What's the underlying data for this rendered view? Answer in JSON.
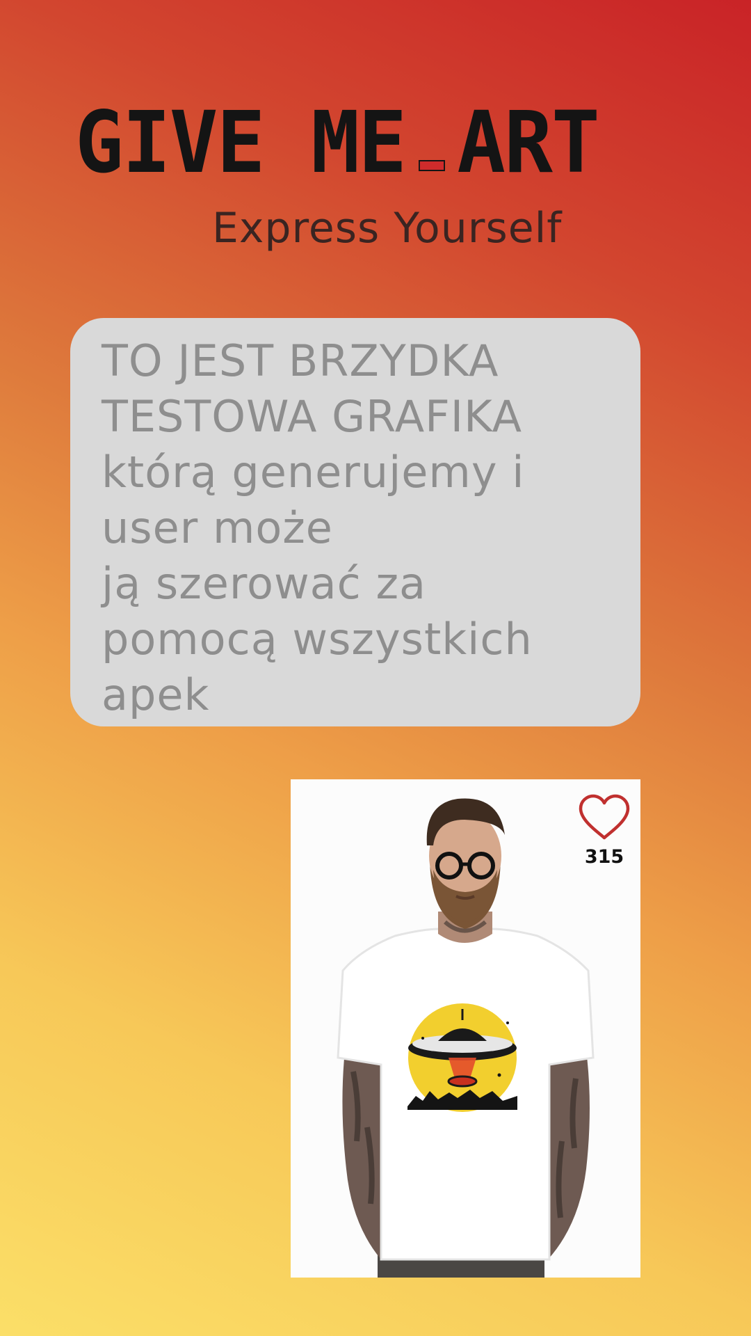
{
  "header": {
    "logo_part1": "GIVE ME",
    "logo_part2": "ART",
    "tagline": "Express Yourself"
  },
  "message": {
    "lines": [
      "TO JEST BRZYDKA",
      "TESTOWA GRAFIKA",
      "którą generujemy i",
      "user może",
      "ją szerować za",
      "pomocą wszystkich",
      "apek"
    ]
  },
  "product": {
    "likes": "315",
    "heart_icon": "heart-outline-icon",
    "colors": {
      "heart": "#c0302f",
      "print_circle": "#f2cf2e",
      "shirt": "#ffffff"
    }
  },
  "theme": {
    "gradient_top": "#c92327",
    "gradient_bottom": "#fbdf68",
    "card_bg": "#d9d9d9"
  }
}
